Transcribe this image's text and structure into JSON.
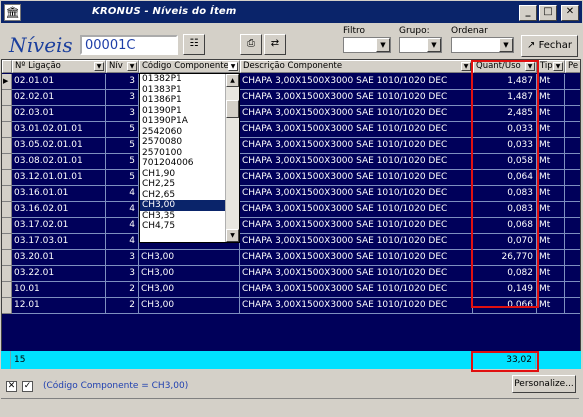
{
  "window": {
    "title": "KRONUS - Níveis do Ítem",
    "app_icon": "building-icon",
    "min": "_",
    "max": "□",
    "close": "✕"
  },
  "toolbar": {
    "brand": "Níveis",
    "code": "00001C",
    "filter_label": "Filtro",
    "group_label": "Grupo:",
    "order_label": "Ordenar",
    "close_label": "Fechar"
  },
  "columns": [
    {
      "label": "Nº Ligação"
    },
    {
      "label": "Nív"
    },
    {
      "label": "Código Componente"
    },
    {
      "label": "Descrição Componente"
    },
    {
      "label": "Quant/Uso"
    },
    {
      "label": "Tip"
    },
    {
      "label": "Pe"
    }
  ],
  "rows": [
    {
      "lig": "02.01.01",
      "niv": "3",
      "cod": "",
      "desc": "CHAPA 3,00X1500X3000 SAE 1010/1020 DEC",
      "qty": "1,487",
      "tip": "Mt",
      "current": true
    },
    {
      "lig": "02.02.01",
      "niv": "3",
      "cod": "",
      "desc": "CHAPA 3,00X1500X3000 SAE 1010/1020 DEC",
      "qty": "1,487",
      "tip": "Mt"
    },
    {
      "lig": "02.03.01",
      "niv": "3",
      "cod": "",
      "desc": "CHAPA 3,00X1500X3000 SAE 1010/1020 DEC",
      "qty": "2,485",
      "tip": "Mt"
    },
    {
      "lig": "03.01.02.01.01",
      "niv": "5",
      "cod": "",
      "desc": "CHAPA 3,00X1500X3000 SAE 1010/1020 DEC",
      "qty": "0,033",
      "tip": "Mt"
    },
    {
      "lig": "03.05.02.01.01",
      "niv": "5",
      "cod": "",
      "desc": "CHAPA 3,00X1500X3000 SAE 1010/1020 DEC",
      "qty": "0,033",
      "tip": "Mt"
    },
    {
      "lig": "03.08.02.01.01",
      "niv": "5",
      "cod": "",
      "desc": "CHAPA 3,00X1500X3000 SAE 1010/1020 DEC",
      "qty": "0,058",
      "tip": "Mt"
    },
    {
      "lig": "03.12.01.01.01",
      "niv": "5",
      "cod": "",
      "desc": "CHAPA 3,00X1500X3000 SAE 1010/1020 DEC",
      "qty": "0,064",
      "tip": "Mt"
    },
    {
      "lig": "03.16.01.01",
      "niv": "4",
      "cod": "",
      "desc": "CHAPA 3,00X1500X3000 SAE 1010/1020 DEC",
      "qty": "0,083",
      "tip": "Mt"
    },
    {
      "lig": "03.16.02.01",
      "niv": "4",
      "cod": "",
      "desc": "CHAPA 3,00X1500X3000 SAE 1010/1020 DEC",
      "qty": "0,083",
      "tip": "Mt"
    },
    {
      "lig": "03.17.02.01",
      "niv": "4",
      "cod": "",
      "desc": "CHAPA 3,00X1500X3000 SAE 1010/1020 DEC",
      "qty": "0,068",
      "tip": "Mt"
    },
    {
      "lig": "03.17.03.01",
      "niv": "4",
      "cod": "",
      "desc": "CHAPA 3,00X1500X3000 SAE 1010/1020 DEC",
      "qty": "0,070",
      "tip": "Mt"
    },
    {
      "lig": "03.20.01",
      "niv": "3",
      "cod": "CH3,00",
      "desc": "CHAPA 3,00X1500X3000 SAE 1010/1020 DEC",
      "qty": "26,770",
      "tip": "Mt"
    },
    {
      "lig": "03.22.01",
      "niv": "3",
      "cod": "CH3,00",
      "desc": "CHAPA 3,00X1500X3000 SAE 1010/1020 DEC",
      "qty": "0,082",
      "tip": "Mt"
    },
    {
      "lig": "10.01",
      "niv": "2",
      "cod": "CH3,00",
      "desc": "CHAPA 3,00X1500X3000 SAE 1010/1020 DEC",
      "qty": "0,149",
      "tip": "Mt"
    },
    {
      "lig": "12.01",
      "niv": "2",
      "cod": "CH3,00",
      "desc": "CHAPA 3,00X1500X3000 SAE 1010/1020 DEC",
      "qty": "0,066",
      "tip": "Mt"
    }
  ],
  "dropdown": {
    "items": [
      "01382P1",
      "01383P1",
      "01386P1",
      "01390P1",
      "01390P1A",
      "2542060",
      "2570080",
      "2570100",
      "701204006",
      "CH1,90",
      "CH2,25",
      "CH2,65",
      "CH3,00",
      "CH3,35",
      "CH4,75"
    ],
    "selected": "CH3,00"
  },
  "footer": {
    "count": "15",
    "total": "33,02"
  },
  "status": {
    "close_filter": "✕",
    "check": "✓",
    "filter_text": "(Código Componente = CH3,00)",
    "personalize": "Personalize..."
  },
  "colors": {
    "grid_bg": "#00005a",
    "footer_bg": "#00e1ff",
    "highlight": "#e01010",
    "title_bg": "#0a246a"
  }
}
